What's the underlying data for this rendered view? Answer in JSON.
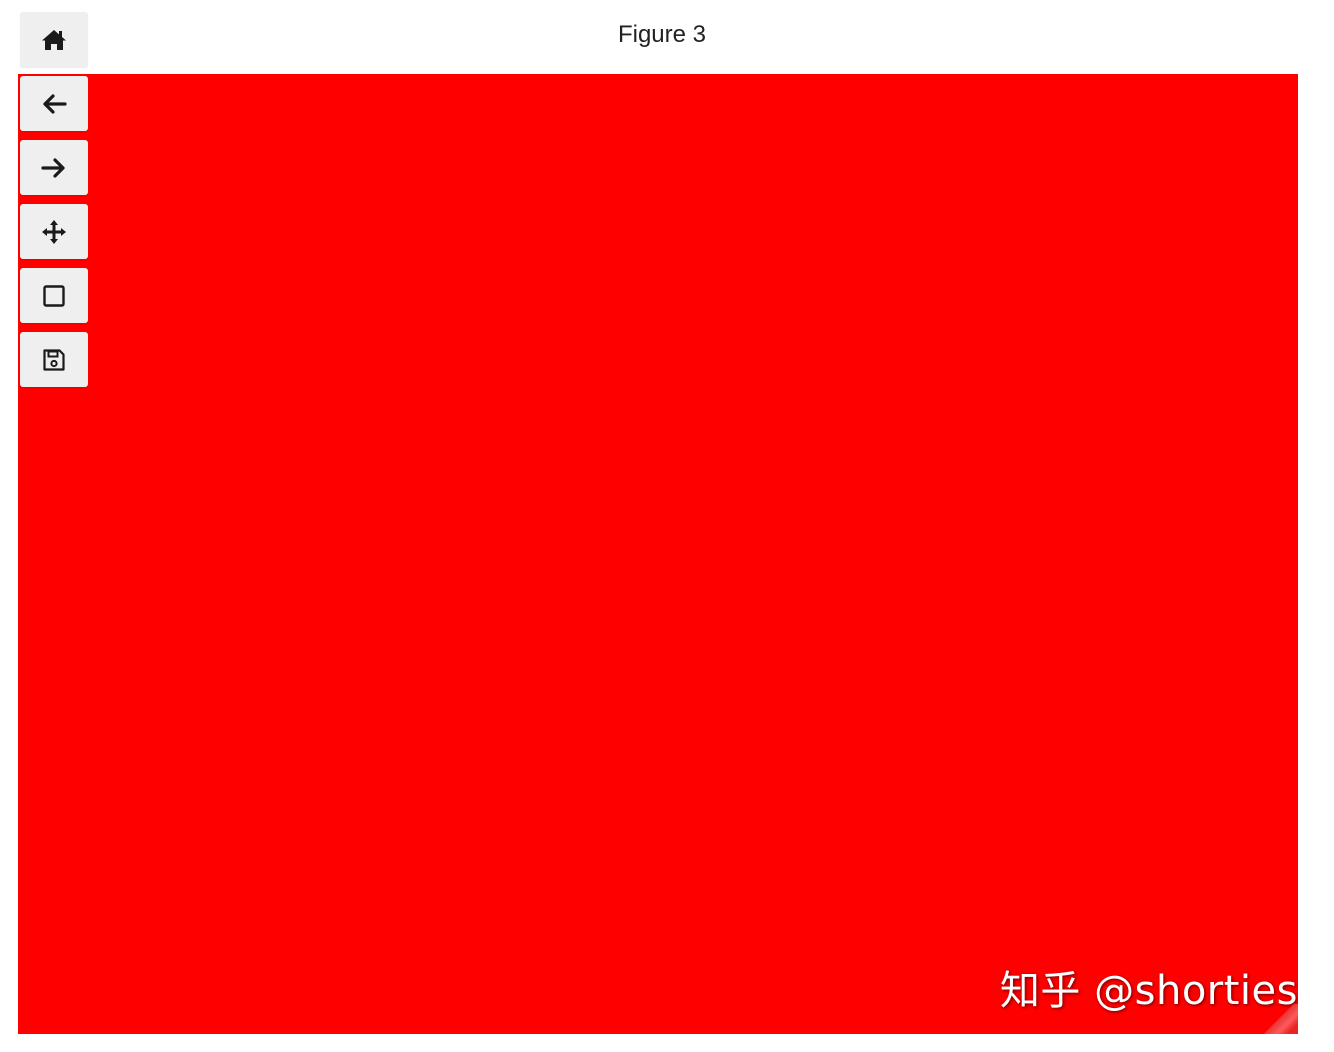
{
  "window": {
    "title": "Figure 3"
  },
  "toolbar": {
    "buttons": [
      {
        "name": "home",
        "icon": "home-icon"
      },
      {
        "name": "back",
        "icon": "arrow-left-icon"
      },
      {
        "name": "forward",
        "icon": "arrow-right-icon"
      },
      {
        "name": "pan",
        "icon": "move-arrows-icon"
      },
      {
        "name": "zoom",
        "icon": "square-icon"
      },
      {
        "name": "save",
        "icon": "floppy-disk-icon"
      }
    ]
  },
  "canvas": {
    "background_color": "#ff0000",
    "watermark": "知乎 @shorties"
  }
}
